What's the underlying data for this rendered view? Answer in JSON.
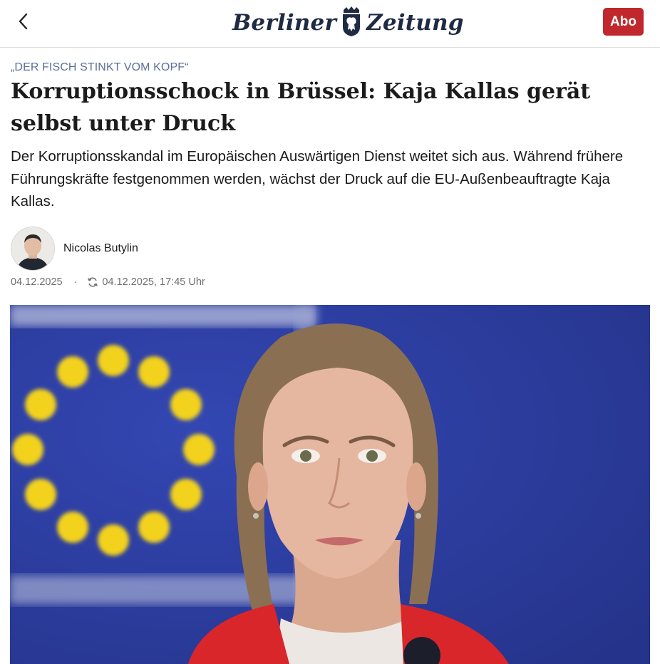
{
  "header": {
    "back_icon": "chevron-left-icon",
    "logo_text_left": "Berliner",
    "logo_text_right": "Zeitung",
    "crest_icon": "bear-crest-icon",
    "abo_label": "Abo",
    "abo_color": "#c0282d"
  },
  "article": {
    "kicker": "„DER FISCH STINKT VOM KOPF“",
    "headline": "Korruptionsschock in Brüssel: Kaja Kallas gerät selbst unter Druck",
    "lead": "Der Korruptionsskandal im Europäischen Auswärtigen Dienst weitet sich aus. Während frühere Führungskräfte festgenommen werden, wächst der Druck auf die EU-Außenbeauftragte Kaja Kallas.",
    "author": "Nicolas Butylin",
    "published": "04.12.2025",
    "separator": "·",
    "updated_icon": "refresh-icon",
    "updated": "04.12.2025, 17:45 Uhr"
  },
  "colors": {
    "kicker": "#5b6f9a",
    "eu_blue": "#2d3d9c",
    "eu_star": "#f2d21b",
    "jacket_red": "#d9262b"
  }
}
